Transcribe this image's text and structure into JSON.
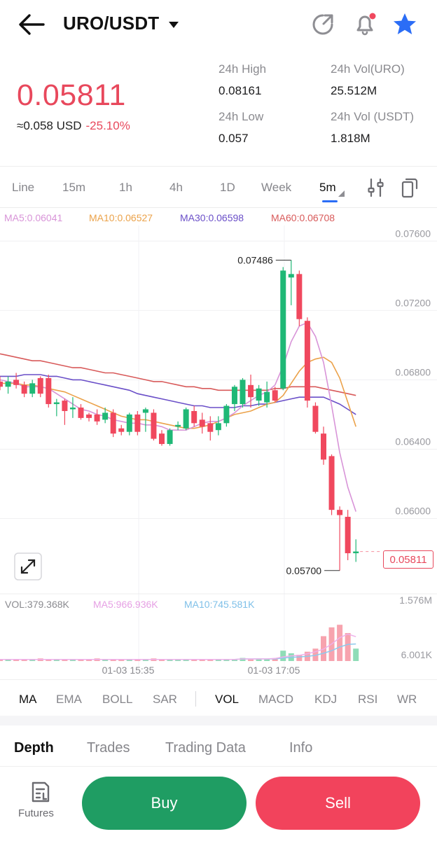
{
  "header": {
    "pair": "URO/USDT"
  },
  "ticker": {
    "price": "0.05811",
    "fiat": "≈0.058 USD",
    "change": "-25.10%",
    "high_label": "24h High",
    "high_value": "0.08161",
    "low_label": "24h Low",
    "low_value": "0.057",
    "vol_base_label": "24h Vol(URO)",
    "vol_base_value": "25.512M",
    "vol_quote_label": "24h Vol (USDT)",
    "vol_quote_value": "1.818M"
  },
  "timeframes": [
    "Line",
    "15m",
    "1h",
    "4h",
    "1D",
    "Week",
    "5m"
  ],
  "active_timeframe": "5m",
  "ma_legend": {
    "ma5": "MA5:0.06041",
    "ma10": "MA10:0.06527",
    "ma30": "MA30:0.06598",
    "ma60": "MA60:0.06708"
  },
  "vol_legend": {
    "vol": "VOL:379.368K",
    "ma5": "MA5:966.936K",
    "ma10": "MA10:745.581K"
  },
  "price_tag": "0.05811",
  "colors": {
    "up": "#1fb876",
    "down": "#f0485e",
    "ma5": "#d894d8",
    "ma10": "#eba24a",
    "ma30": "#6a4fc8",
    "ma60": "#d85a5a",
    "accent": "#2b6df6"
  },
  "indicators": [
    "MA",
    "EMA",
    "BOLL",
    "SAR",
    "VOL",
    "MACD",
    "KDJ",
    "RSI",
    "WR"
  ],
  "active_indicators": [
    "MA",
    "VOL"
  ],
  "bottom_tabs": [
    "Depth",
    "Trades",
    "Trading Data",
    "Info"
  ],
  "active_bottom_tab": "Depth",
  "actions": {
    "futures": "Futures",
    "buy": "Buy",
    "sell": "Sell"
  },
  "chart_data": {
    "type": "candlestick",
    "price_axis": [
      "0.07600",
      "0.07200",
      "0.06800",
      "0.06400",
      "0.06000"
    ],
    "price_range": [
      0.0557,
      0.0769
    ],
    "volume_axis": [
      "1.576M",
      "6.001K"
    ],
    "time_labels": [
      "01-03 15:35",
      "01-03 17:05"
    ],
    "high_marker": "0.07486",
    "low_marker": "0.05700",
    "candles": [
      {
        "o": 0.0679,
        "h": 0.0682,
        "l": 0.0674,
        "c": 0.0676
      },
      {
        "o": 0.0676,
        "h": 0.0682,
        "l": 0.0672,
        "c": 0.0679
      },
      {
        "o": 0.068,
        "h": 0.0684,
        "l": 0.0675,
        "c": 0.0677
      },
      {
        "o": 0.0677,
        "h": 0.0679,
        "l": 0.067,
        "c": 0.0672
      },
      {
        "o": 0.0672,
        "h": 0.068,
        "l": 0.067,
        "c": 0.0678
      },
      {
        "o": 0.0681,
        "h": 0.0682,
        "l": 0.067,
        "c": 0.0672
      },
      {
        "o": 0.0681,
        "h": 0.0683,
        "l": 0.0664,
        "c": 0.0666
      },
      {
        "o": 0.0666,
        "h": 0.0669,
        "l": 0.0659,
        "c": 0.0667
      },
      {
        "o": 0.0668,
        "h": 0.0669,
        "l": 0.0654,
        "c": 0.0662
      },
      {
        "o": 0.0663,
        "h": 0.067,
        "l": 0.0658,
        "c": 0.0664
      },
      {
        "o": 0.0664,
        "h": 0.0666,
        "l": 0.0657,
        "c": 0.0658
      },
      {
        "o": 0.066,
        "h": 0.0661,
        "l": 0.0656,
        "c": 0.0658
      },
      {
        "o": 0.066,
        "h": 0.0663,
        "l": 0.0654,
        "c": 0.0656
      },
      {
        "o": 0.0657,
        "h": 0.0664,
        "l": 0.0655,
        "c": 0.0661
      },
      {
        "o": 0.0661,
        "h": 0.0663,
        "l": 0.0647,
        "c": 0.0649
      },
      {
        "o": 0.0652,
        "h": 0.0654,
        "l": 0.0648,
        "c": 0.065
      },
      {
        "o": 0.065,
        "h": 0.0661,
        "l": 0.0648,
        "c": 0.066
      },
      {
        "o": 0.066,
        "h": 0.0662,
        "l": 0.0648,
        "c": 0.065
      },
      {
        "o": 0.0661,
        "h": 0.0664,
        "l": 0.065,
        "c": 0.0663
      },
      {
        "o": 0.0661,
        "h": 0.0663,
        "l": 0.0645,
        "c": 0.0646
      },
      {
        "o": 0.0649,
        "h": 0.0651,
        "l": 0.0642,
        "c": 0.0643
      },
      {
        "o": 0.0643,
        "h": 0.0652,
        "l": 0.0642,
        "c": 0.0651
      },
      {
        "o": 0.0653,
        "h": 0.0656,
        "l": 0.0651,
        "c": 0.0654
      },
      {
        "o": 0.0652,
        "h": 0.0664,
        "l": 0.0651,
        "c": 0.0663
      },
      {
        "o": 0.0662,
        "h": 0.0665,
        "l": 0.0653,
        "c": 0.0655
      },
      {
        "o": 0.0657,
        "h": 0.0661,
        "l": 0.0649,
        "c": 0.0653
      },
      {
        "o": 0.0655,
        "h": 0.0659,
        "l": 0.0645,
        "c": 0.065
      },
      {
        "o": 0.0651,
        "h": 0.0659,
        "l": 0.0648,
        "c": 0.0655
      },
      {
        "o": 0.0655,
        "h": 0.0666,
        "l": 0.0653,
        "c": 0.0665
      },
      {
        "o": 0.0666,
        "h": 0.0677,
        "l": 0.0662,
        "c": 0.0676
      },
      {
        "o": 0.0666,
        "h": 0.0681,
        "l": 0.0664,
        "c": 0.068
      },
      {
        "o": 0.0677,
        "h": 0.0683,
        "l": 0.0664,
        "c": 0.067
      },
      {
        "o": 0.0668,
        "h": 0.0677,
        "l": 0.0665,
        "c": 0.0675
      },
      {
        "o": 0.0667,
        "h": 0.0679,
        "l": 0.0664,
        "c": 0.0673
      },
      {
        "o": 0.0674,
        "h": 0.0676,
        "l": 0.0667,
        "c": 0.0668
      },
      {
        "o": 0.0675,
        "h": 0.0745,
        "l": 0.0674,
        "c": 0.0743
      },
      {
        "o": 0.0739,
        "h": 0.0749,
        "l": 0.0723,
        "c": 0.0741
      },
      {
        "o": 0.0741,
        "h": 0.0743,
        "l": 0.0711,
        "c": 0.0715
      },
      {
        "o": 0.0714,
        "h": 0.0716,
        "l": 0.0664,
        "c": 0.0668
      },
      {
        "o": 0.0665,
        "h": 0.0667,
        "l": 0.0649,
        "c": 0.065
      },
      {
        "o": 0.0649,
        "h": 0.0653,
        "l": 0.0631,
        "c": 0.0634
      },
      {
        "o": 0.0636,
        "h": 0.0637,
        "l": 0.0602,
        "c": 0.0605
      },
      {
        "o": 0.0605,
        "h": 0.0607,
        "l": 0.057,
        "c": 0.0602
      },
      {
        "o": 0.0601,
        "h": 0.0605,
        "l": 0.0576,
        "c": 0.058
      },
      {
        "o": 0.058,
        "h": 0.0588,
        "l": 0.0575,
        "c": 0.0581
      }
    ],
    "ma5": [
      0.068,
      0.0679,
      0.0678,
      0.0676,
      0.0676,
      0.0676,
      0.0675,
      0.0672,
      0.0669,
      0.0666,
      0.0663,
      0.0662,
      0.066,
      0.0659,
      0.0657,
      0.0656,
      0.0655,
      0.0655,
      0.0654,
      0.0654,
      0.0653,
      0.0651,
      0.0651,
      0.0651,
      0.0653,
      0.0655,
      0.0656,
      0.0656,
      0.0658,
      0.0661,
      0.0665,
      0.0668,
      0.0671,
      0.0673,
      0.0677,
      0.0688,
      0.0702,
      0.0711,
      0.0713,
      0.0705,
      0.069,
      0.0665,
      0.0638,
      0.0618,
      0.0604
    ],
    "ma10": [
      0.0678,
      0.0678,
      0.0678,
      0.0677,
      0.0677,
      0.0676,
      0.0675,
      0.0674,
      0.0673,
      0.0671,
      0.0669,
      0.0667,
      0.0665,
      0.0663,
      0.0661,
      0.0659,
      0.0658,
      0.0657,
      0.0657,
      0.0656,
      0.0655,
      0.0654,
      0.0653,
      0.0652,
      0.0652,
      0.0653,
      0.0654,
      0.0656,
      0.0658,
      0.066,
      0.0661,
      0.0662,
      0.0664,
      0.0666,
      0.0667,
      0.0671,
      0.0678,
      0.0685,
      0.069,
      0.0692,
      0.0693,
      0.069,
      0.0681,
      0.0667,
      0.0653
    ],
    "ma30": [
      0.0682,
      0.0682,
      0.0682,
      0.0683,
      0.0683,
      0.0683,
      0.0682,
      0.0682,
      0.0681,
      0.068,
      0.068,
      0.0679,
      0.0678,
      0.0677,
      0.0676,
      0.0675,
      0.0674,
      0.0672,
      0.0671,
      0.067,
      0.0669,
      0.0668,
      0.0667,
      0.0666,
      0.0665,
      0.0665,
      0.0664,
      0.0664,
      0.0664,
      0.0664,
      0.0665,
      0.0665,
      0.0666,
      0.0666,
      0.0667,
      0.0668,
      0.0669,
      0.067,
      0.067,
      0.067,
      0.067,
      0.0668,
      0.0666,
      0.0663,
      0.066
    ],
    "ma60": [
      0.0695,
      0.0694,
      0.0693,
      0.0692,
      0.0691,
      0.0691,
      0.069,
      0.0689,
      0.0688,
      0.0687,
      0.0687,
      0.0686,
      0.0685,
      0.0684,
      0.0684,
      0.0683,
      0.0682,
      0.0681,
      0.068,
      0.0679,
      0.0679,
      0.0678,
      0.0677,
      0.0676,
      0.0676,
      0.0675,
      0.0675,
      0.0674,
      0.0674,
      0.0674,
      0.0674,
      0.0674,
      0.0674,
      0.0674,
      0.0675,
      0.0675,
      0.0676,
      0.0676,
      0.0676,
      0.0676,
      0.0675,
      0.0674,
      0.0673,
      0.0672,
      0.0671
    ],
    "volume": [
      0.03,
      0.03,
      0.04,
      0.02,
      0.03,
      0.05,
      0.03,
      0.04,
      0.02,
      0.03,
      0.04,
      0.03,
      0.05,
      0.02,
      0.03,
      0.03,
      0.04,
      0.02,
      0.03,
      0.05,
      0.04,
      0.03,
      0.03,
      0.04,
      0.02,
      0.03,
      0.04,
      0.03,
      0.03,
      0.04,
      0.06,
      0.03,
      0.05,
      0.04,
      0.05,
      0.2,
      0.15,
      0.12,
      0.18,
      0.24,
      0.48,
      0.65,
      0.7,
      0.54,
      0.24
    ],
    "vol_ma5": [
      0.03,
      0.03,
      0.03,
      0.03,
      0.03,
      0.03,
      0.03,
      0.03,
      0.03,
      0.03,
      0.03,
      0.03,
      0.03,
      0.03,
      0.03,
      0.03,
      0.03,
      0.03,
      0.03,
      0.03,
      0.03,
      0.03,
      0.03,
      0.03,
      0.03,
      0.03,
      0.03,
      0.03,
      0.03,
      0.03,
      0.04,
      0.04,
      0.04,
      0.04,
      0.05,
      0.08,
      0.1,
      0.11,
      0.14,
      0.18,
      0.23,
      0.33,
      0.45,
      0.52,
      0.47
    ],
    "vol_ma10": [
      0.03,
      0.03,
      0.03,
      0.03,
      0.03,
      0.03,
      0.03,
      0.03,
      0.03,
      0.03,
      0.03,
      0.03,
      0.03,
      0.03,
      0.03,
      0.03,
      0.03,
      0.03,
      0.03,
      0.03,
      0.03,
      0.03,
      0.03,
      0.03,
      0.03,
      0.03,
      0.03,
      0.03,
      0.03,
      0.03,
      0.04,
      0.04,
      0.04,
      0.04,
      0.04,
      0.06,
      0.07,
      0.08,
      0.09,
      0.11,
      0.15,
      0.2,
      0.27,
      0.32,
      0.33
    ]
  }
}
